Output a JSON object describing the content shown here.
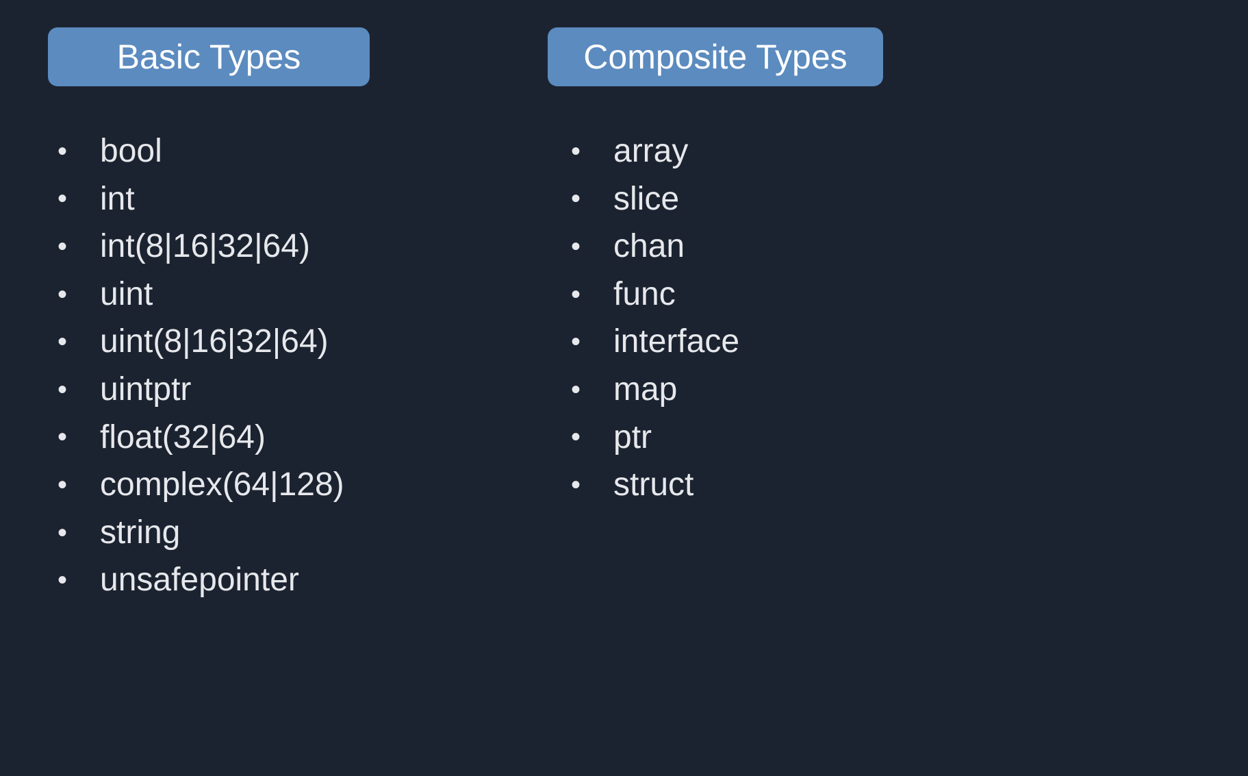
{
  "left": {
    "title": "Basic Types",
    "items": [
      "bool",
      "int",
      "int(8|16|32|64)",
      "uint",
      "uint(8|16|32|64)",
      "uintptr",
      "float(32|64)",
      "complex(64|128)",
      "string",
      "unsafepointer"
    ]
  },
  "right": {
    "title": "Composite Types",
    "items": [
      "array",
      "slice",
      "chan",
      "func",
      "interface",
      "map",
      "ptr",
      "struct"
    ]
  }
}
